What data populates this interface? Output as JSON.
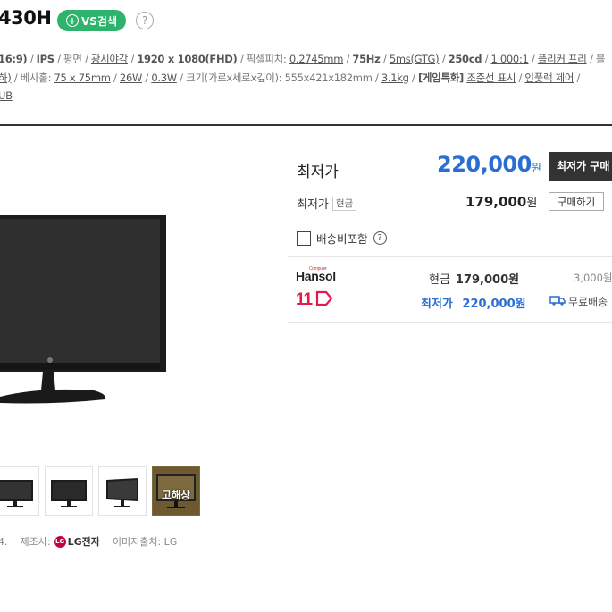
{
  "product": {
    "title": "430H",
    "vs_button": "VS검색",
    "help": "?"
  },
  "specs": {
    "line1": [
      {
        "text": "16:9)",
        "style": "bold"
      },
      {
        "text": " / ",
        "style": "plain"
      },
      {
        "text": "IPS",
        "style": "bold"
      },
      {
        "text": " / 평면 / ",
        "style": "plain"
      },
      {
        "text": "광시야각",
        "style": "u"
      },
      {
        "text": " / ",
        "style": "plain"
      },
      {
        "text": "1920 x 1080(FHD)",
        "style": "bold"
      },
      {
        "text": " / 픽셀피치: ",
        "style": "plain"
      },
      {
        "text": "0.2745mm",
        "style": "u"
      },
      {
        "text": " / ",
        "style": "plain"
      },
      {
        "text": "75Hz",
        "style": "bold"
      },
      {
        "text": " / ",
        "style": "plain"
      },
      {
        "text": "5ms(GTG)",
        "style": "u"
      },
      {
        "text": " / ",
        "style": "plain"
      },
      {
        "text": "250cd",
        "style": "bold"
      },
      {
        "text": " / ",
        "style": "plain"
      },
      {
        "text": "1,000:1",
        "style": "u"
      },
      {
        "text": " / ",
        "style": "plain"
      },
      {
        "text": "플리커 프리",
        "style": "u"
      },
      {
        "text": " / 블",
        "style": "plain"
      }
    ],
    "line2": [
      {
        "text": "하)",
        "style": "u"
      },
      {
        "text": " / 베사홀: ",
        "style": "plain"
      },
      {
        "text": "75 x 75mm",
        "style": "u"
      },
      {
        "text": " / ",
        "style": "plain"
      },
      {
        "text": "26W",
        "style": "u"
      },
      {
        "text": " / ",
        "style": "plain"
      },
      {
        "text": "0.3W",
        "style": "u"
      },
      {
        "text": " / 크기(가로x세로x깊이): 555x421x182mm / ",
        "style": "plain"
      },
      {
        "text": "3.1kg",
        "style": "u"
      },
      {
        "text": " / ",
        "style": "plain"
      },
      {
        "text": "[게임특화]",
        "style": "bold"
      },
      {
        "text": " ",
        "style": "plain"
      },
      {
        "text": "조준선 표시",
        "style": "u"
      },
      {
        "text": " / ",
        "style": "plain"
      },
      {
        "text": "인풋랙 제어",
        "style": "u"
      },
      {
        "text": " / ",
        "style": "plain"
      }
    ],
    "line3": [
      {
        "text": "UB",
        "style": "u"
      }
    ]
  },
  "thumbnails": [
    {
      "label": ""
    },
    {
      "label": ""
    },
    {
      "label": ""
    },
    {
      "label": "고해상"
    }
  ],
  "maker_info": {
    "date_fragment": "4.",
    "maker_label": "제조사:",
    "maker_logo": "LG",
    "maker_name": "LG전자",
    "image_source": "이미지출처: LG"
  },
  "price": {
    "lowest_label": "최저가",
    "lowest_value": "220,000",
    "won": "원",
    "buy_label": "최저가 구매",
    "cash_label": "최저가",
    "cash_tag": "현금",
    "cash_value": "179,000",
    "buy_outline": "구매하기",
    "shipping_check": "배송비포함",
    "help": "?"
  },
  "shops": [
    {
      "logo": "Hansol",
      "logo_small": "Computer",
      "price_label": "현금",
      "price": "179,000원",
      "shipping": "3,000원"
    },
    {
      "logo": "11",
      "price_label": "최저가",
      "price": "220,000원",
      "shipping": "무료배송"
    }
  ],
  "colors": {
    "accent_blue": "#2a6ed4",
    "vs_green": "#2db36b",
    "eleven_red": "#e6194b",
    "lg_red": "#c4004a"
  }
}
